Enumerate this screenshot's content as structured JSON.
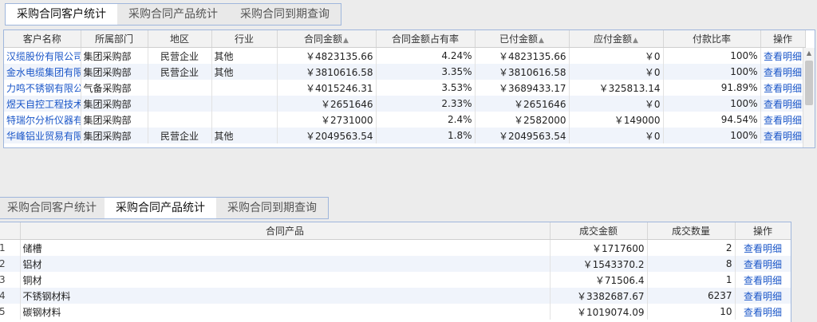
{
  "top_tabs": [
    "采购合同客户统计",
    "采购合同产品统计",
    "采购合同到期查询"
  ],
  "customer_table": {
    "headers": [
      "客户名称",
      "所属部门",
      "地区",
      "行业",
      "合同金额",
      "合同金额占有率",
      "已付金额",
      "应付金额",
      "付款比率",
      "操作"
    ],
    "sortable": [
      false,
      false,
      false,
      false,
      true,
      false,
      true,
      true,
      false,
      false
    ],
    "rows": [
      [
        "汉缆股份有限公司",
        "集团采购部",
        "民营企业",
        "其他",
        "￥4823135.66",
        "4.24%",
        "￥4823135.66",
        "￥0",
        "100%",
        "查看明细"
      ],
      [
        "金水电缆集团有限公司",
        "集团采购部",
        "民营企业",
        "其他",
        "￥3810616.58",
        "3.35%",
        "￥3810616.58",
        "￥0",
        "100%",
        "查看明细"
      ],
      [
        "力鸣不锈钢有限公司",
        "气备采购部",
        "",
        "",
        "￥4015246.31",
        "3.53%",
        "￥3689433.17",
        "￥325813.14",
        "91.89%",
        "查看明细"
      ],
      [
        "煜天自控工程技术有限公司",
        "集团采购部",
        "",
        "",
        "￥2651646",
        "2.33%",
        "￥2651646",
        "￥0",
        "100%",
        "查看明细"
      ],
      [
        "特瑞尔分析仪器有限公司",
        "集团采购部",
        "",
        "",
        "￥2731000",
        "2.4%",
        "￥2582000",
        "￥149000",
        "94.54%",
        "查看明细"
      ],
      [
        "华峰铝业贸易有限公司",
        "集团采购部",
        "民营企业",
        "其他",
        "￥2049563.54",
        "1.8%",
        "￥2049563.54",
        "￥0",
        "100%",
        "查看明细"
      ]
    ]
  },
  "bottom_tabs": [
    "采购合同客户统计",
    "采购合同产品统计",
    "采购合同到期查询"
  ],
  "product_table": {
    "headers": [
      "",
      "合同产品",
      "成交金额",
      "成交数量",
      "操作"
    ],
    "rows": [
      [
        "1",
        "储槽",
        "￥1717600",
        "2",
        "查看明细"
      ],
      [
        "2",
        "铝材",
        "￥1543370.2",
        "8",
        "查看明细"
      ],
      [
        "3",
        "铜材",
        "￥71506.4",
        "1",
        "查看明细"
      ],
      [
        "4",
        "不锈钢材料",
        "￥3382687.67",
        "6237",
        "查看明细"
      ],
      [
        "5",
        "碳钢材料",
        "￥1019074.09",
        "10",
        "查看明细"
      ]
    ]
  },
  "colors": {
    "link": "#1a56c8",
    "border": "#9fb6dc",
    "row_alt": "#f0f4fb"
  }
}
